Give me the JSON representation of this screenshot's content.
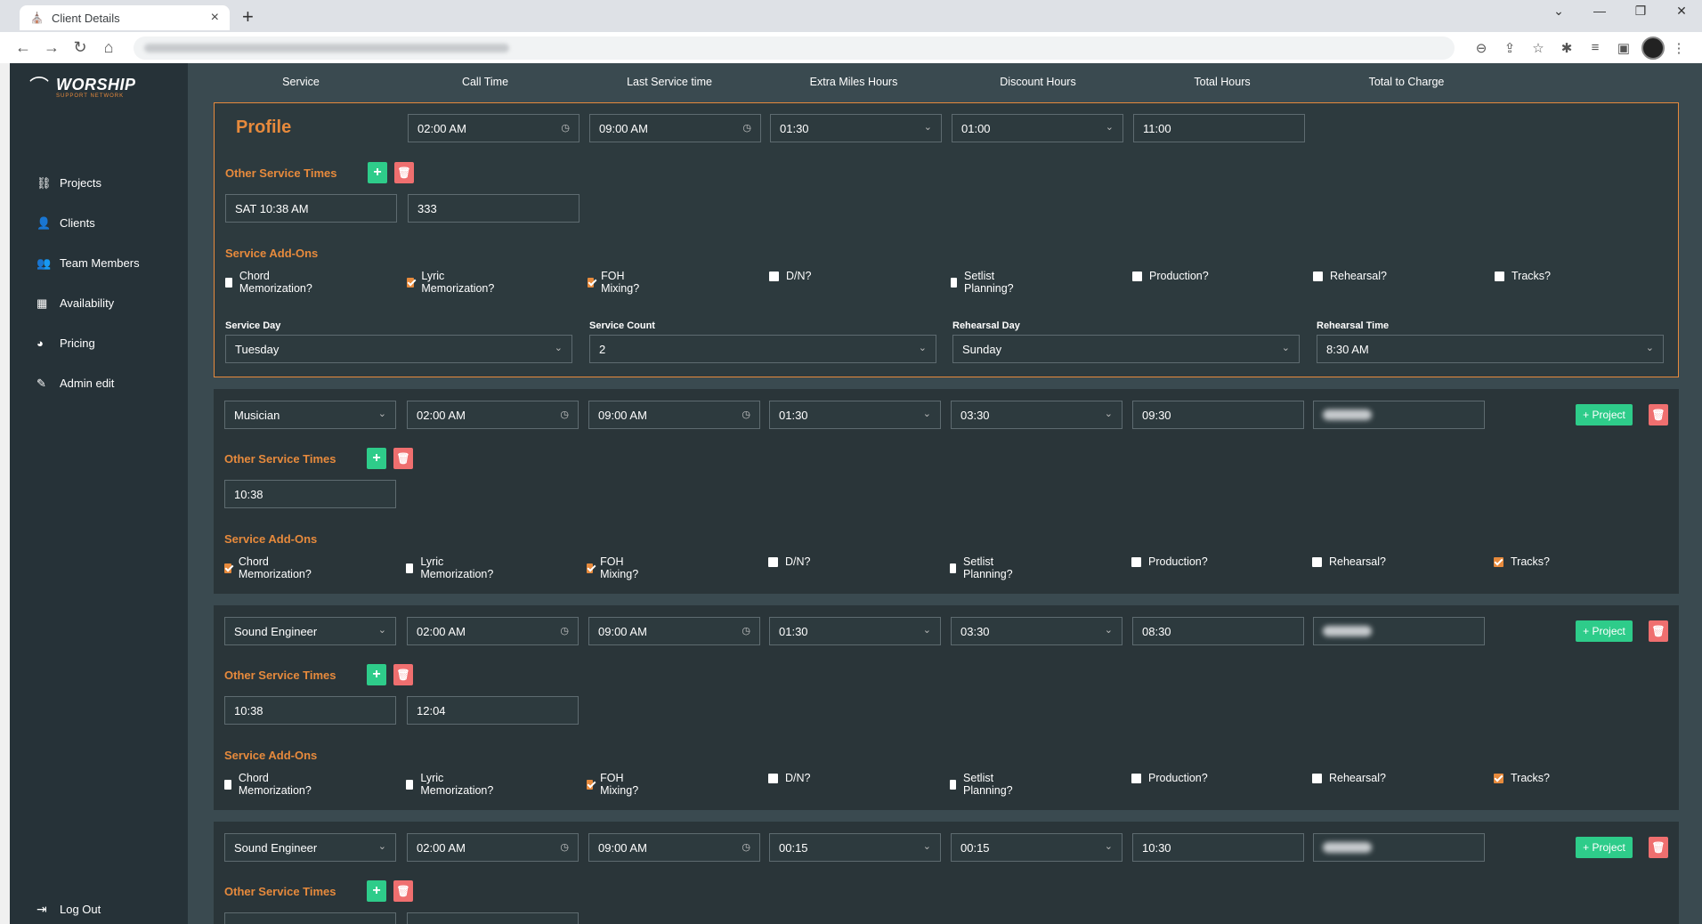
{
  "browser": {
    "tab_title": "Client Details",
    "new_tab": "+",
    "tab_close": "×"
  },
  "sidebar": {
    "logo_main": "WORSHIP",
    "logo_sub": "SUPPORT NETWORK",
    "items": [
      {
        "label": "Projects"
      },
      {
        "label": "Clients"
      },
      {
        "label": "Team Members"
      },
      {
        "label": "Availability"
      },
      {
        "label": "Pricing"
      },
      {
        "label": "Admin edit"
      }
    ],
    "logout": "Log Out"
  },
  "columns": [
    "Service",
    "Call Time",
    "Last Service time",
    "Extra Miles Hours",
    "Discount Hours",
    "Total Hours",
    "Total to Charge"
  ],
  "labels": {
    "other_service_times": "Other Service Times",
    "service_addons": "Service Add-Ons",
    "service_day": "Service Day",
    "service_count": "Service Count",
    "rehearsal_day": "Rehearsal Day",
    "rehearsal_time": "Rehearsal Time",
    "project_button": "+ Project"
  },
  "addons": [
    "Chord Memorization?",
    "Lyric Memorization?",
    "FOH Mixing?",
    "D/N?",
    "Setlist Planning?",
    "Production?",
    "Rehearsal?",
    "Tracks?"
  ],
  "profile": {
    "title": "Profile",
    "call_time": "02:00 AM",
    "last_service": "09:00 AM",
    "extra_miles": "01:30",
    "discount": "01:00",
    "total_hours": "11:00",
    "other_times": [
      "SAT 10:38 AM",
      "333"
    ],
    "addons_checked": [
      false,
      true,
      true,
      false,
      false,
      false,
      false,
      false
    ],
    "service_day": "Tuesday",
    "service_count": "2",
    "rehearsal_day": "Sunday",
    "rehearsal_time": "8:30 AM"
  },
  "services": [
    {
      "service": "Musician",
      "call_time": "02:00 AM",
      "last_service": "09:00 AM",
      "extra_miles": "01:30",
      "discount": "03:30",
      "total_hours": "09:30",
      "other_times": [
        "10:38"
      ],
      "addons_checked": [
        true,
        false,
        true,
        false,
        false,
        false,
        false,
        true
      ]
    },
    {
      "service": "Sound Engineer",
      "call_time": "02:00 AM",
      "last_service": "09:00 AM",
      "extra_miles": "01:30",
      "discount": "03:30",
      "total_hours": "08:30",
      "other_times": [
        "10:38",
        "12:04"
      ],
      "addons_checked": [
        false,
        false,
        true,
        false,
        false,
        false,
        false,
        true
      ]
    },
    {
      "service": "Sound Engineer",
      "call_time": "02:00 AM",
      "last_service": "09:00 AM",
      "extra_miles": "00:15",
      "discount": "00:15",
      "total_hours": "10:30",
      "other_times": [],
      "addons_checked": []
    }
  ]
}
